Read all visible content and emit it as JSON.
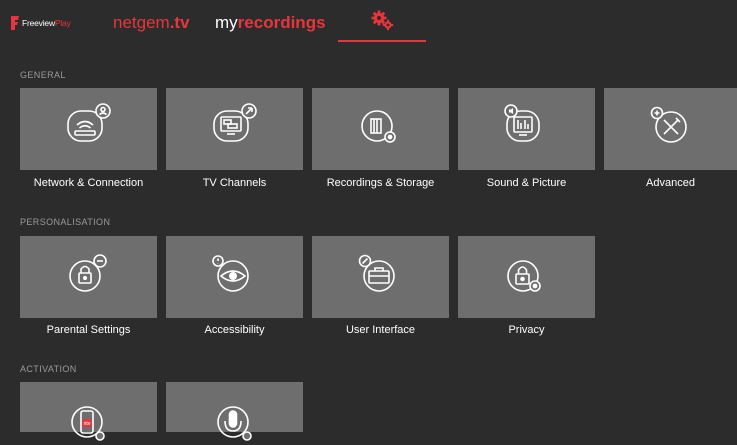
{
  "header": {
    "brand": {
      "name": "Freeview",
      "suffix": "Play"
    },
    "tabs": {
      "netgem": {
        "prefix": "netgem",
        "suffix": ".tv"
      },
      "myrecordings": {
        "prefix": "my",
        "suffix": "recordings"
      },
      "settings": {
        "icon": "gears-icon"
      }
    }
  },
  "colors": {
    "accent": "#e8353c",
    "background": "#2c2c2c",
    "tile": "#6e6e6e",
    "section_label": "#9a9a9a"
  },
  "sections": {
    "general": {
      "label": "GENERAL",
      "items": [
        {
          "label": "Network & Connection",
          "icon": "router-icon"
        },
        {
          "label": "TV Channels",
          "icon": "tv-channels-icon"
        },
        {
          "label": "Recordings & Storage",
          "icon": "storage-icon"
        },
        {
          "label": "Sound & Picture",
          "icon": "equalizer-icon"
        },
        {
          "label": "Advanced",
          "icon": "tools-icon"
        }
      ]
    },
    "personalisation": {
      "label": "PERSONALISATION",
      "items": [
        {
          "label": "Parental Settings",
          "icon": "padlock-icon"
        },
        {
          "label": "Accessibility",
          "icon": "eye-icon"
        },
        {
          "label": "User Interface",
          "icon": "toolbox-icon"
        },
        {
          "label": "Privacy",
          "icon": "privacy-lock-icon"
        }
      ]
    },
    "activation": {
      "label": "ACTIVATION",
      "items": [
        {
          "icon": "mobile-app-icon",
          "badge": "ntv"
        },
        {
          "icon": "microphone-icon"
        }
      ]
    }
  }
}
